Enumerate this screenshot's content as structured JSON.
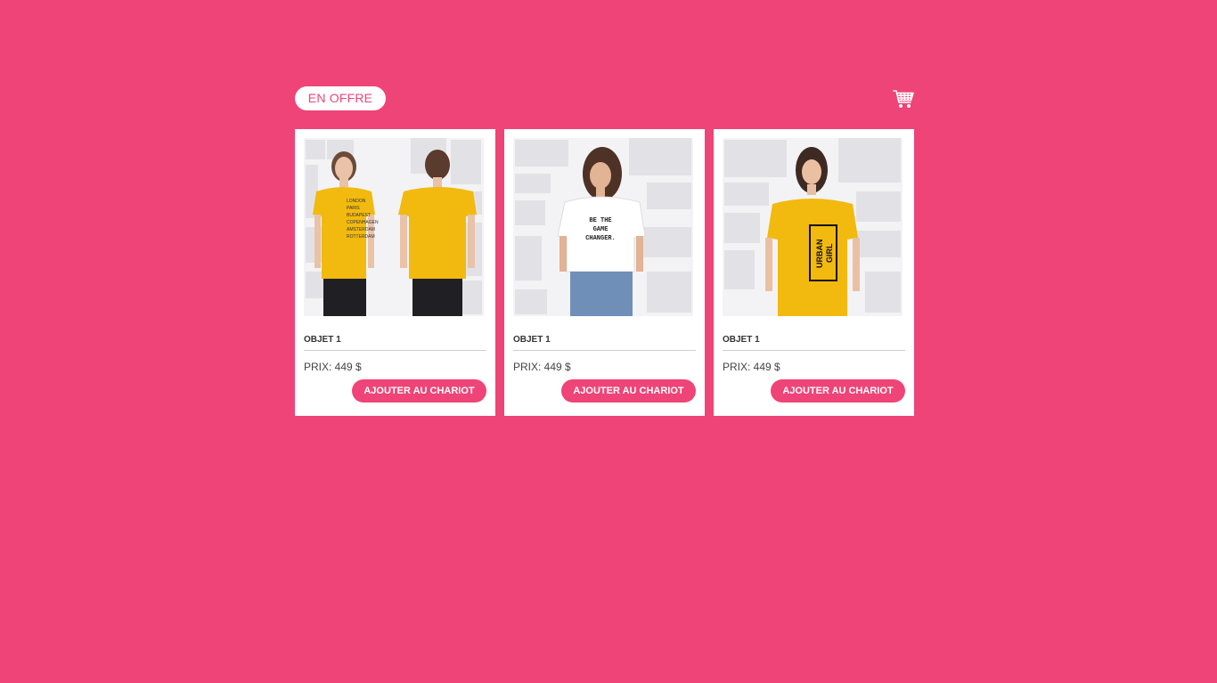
{
  "header": {
    "badge_label": "EN OFFRE",
    "cart_icon": "shopping-cart-icon"
  },
  "colors": {
    "background": "#ef4477",
    "card": "#ffffff",
    "accent": "#ef4477"
  },
  "products": [
    {
      "name": "OBJET 1",
      "price": "PRIX: 449 $",
      "button_label": "AJOUTER AU CHARIOT",
      "image": "woman-yellow-tshirt-front-back",
      "shirt_color": "#f2b90f",
      "shirt_text": ""
    },
    {
      "name": "OBJET 1",
      "price": "PRIX: 449 $",
      "button_label": "AJOUTER AU CHARIOT",
      "image": "woman-white-crop-hoodie",
      "shirt_color": "#ffffff",
      "shirt_text": "BE THE GAME CHANGER."
    },
    {
      "name": "OBJET 1",
      "price": "PRIX: 449 $",
      "button_label": "AJOUTER AU CHARIOT",
      "image": "woman-yellow-urban-girl-tshirt",
      "shirt_color": "#f2b90f",
      "shirt_text": "URBAN GIRL"
    }
  ]
}
